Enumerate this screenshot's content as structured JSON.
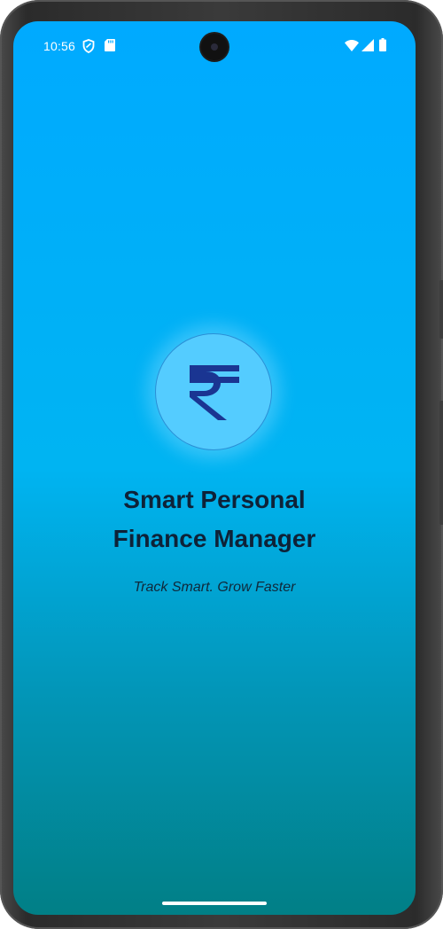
{
  "status_bar": {
    "time": "10:56",
    "icons": [
      "shield-icon",
      "sd-card-icon",
      "wifi-icon",
      "signal-icon",
      "battery-icon"
    ]
  },
  "splash": {
    "logo_icon": "rupee-icon",
    "title_line1": "Smart Personal",
    "title_line2": "Finance Manager",
    "tagline": "Track Smart. Grow Faster"
  },
  "colors": {
    "gradient_top": "#00aaff",
    "gradient_bottom": "#017f86",
    "logo_circle": "#54ccff",
    "rupee": "#1a3592",
    "title_text": "#0e2238"
  }
}
